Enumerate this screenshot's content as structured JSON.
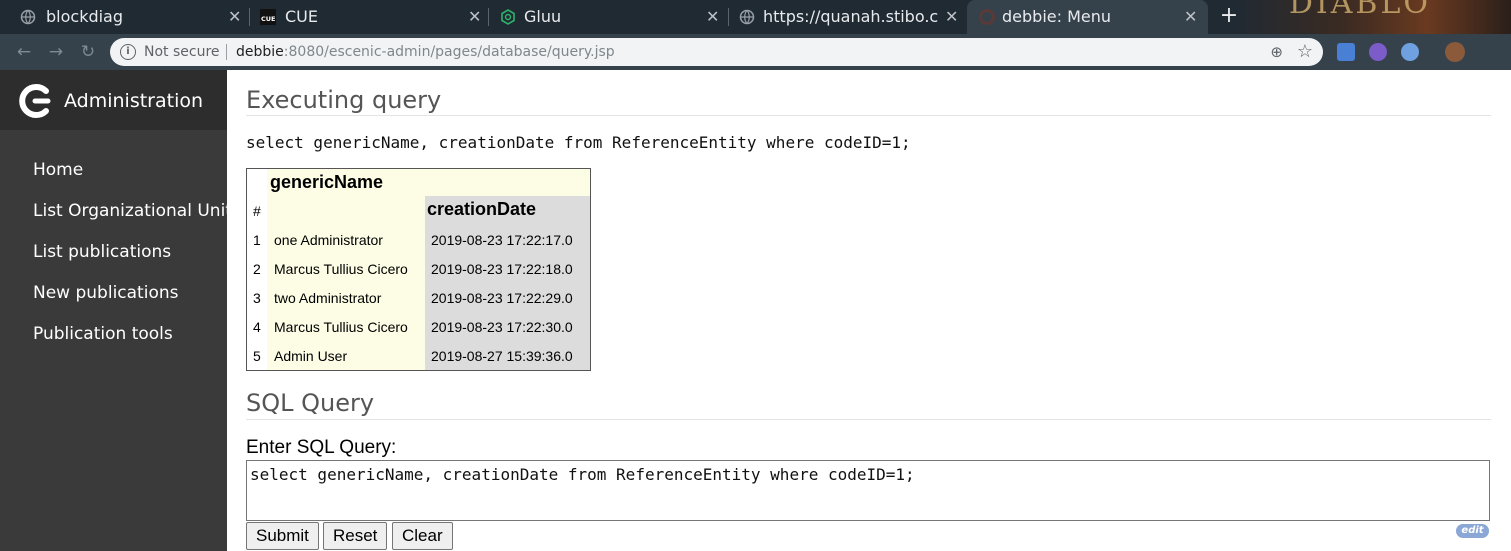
{
  "browser": {
    "tabs": [
      {
        "title": "blockdiag",
        "icon": "globe-icon"
      },
      {
        "title": "CUE",
        "icon": "cue-favicon"
      },
      {
        "title": "Gluu",
        "icon": "gluu-favicon"
      },
      {
        "title": "https://quanah.stibo.co",
        "icon": "globe-icon"
      },
      {
        "title": "debbie: Menu",
        "icon": "escenic-favicon",
        "active": true
      }
    ],
    "background_art_text": "DIABLO",
    "address": {
      "security_label": "Not secure",
      "url_host": "debbie",
      "url_rest": ":8080/escenic-admin/pages/database/query.jsp"
    }
  },
  "sidebar": {
    "brand": "Administration",
    "items": [
      {
        "label": "Home"
      },
      {
        "label": "List Organizational Units"
      },
      {
        "label": "List publications"
      },
      {
        "label": "New publications"
      },
      {
        "label": "Publication tools"
      }
    ]
  },
  "main": {
    "executing_heading": "Executing query",
    "executed_query": "select genericName, creationDate from ReferenceEntity where codeID=1;",
    "result": {
      "col_index_header": "#",
      "col1_header": "genericName",
      "col2_header": "creationDate",
      "rows": [
        {
          "index": "1",
          "name": "one Administrator",
          "date": "2019-08-23 17:22:17.0"
        },
        {
          "index": "2",
          "name": "Marcus Tullius Cicero",
          "date": "2019-08-23 17:22:18.0"
        },
        {
          "index": "3",
          "name": "two Administrator",
          "date": "2019-08-23 17:22:29.0"
        },
        {
          "index": "4",
          "name": "Marcus Tullius Cicero",
          "date": "2019-08-23 17:22:30.0"
        },
        {
          "index": "5",
          "name": "Admin User",
          "date": "2019-08-27 15:39:36.0"
        }
      ]
    },
    "sql_heading": "SQL Query",
    "sql_label": "Enter SQL Query:",
    "sql_value": "select genericName, creationDate from ReferenceEntity where codeID=1;",
    "buttons": {
      "submit": "Submit",
      "reset": "Reset",
      "clear": "Clear"
    },
    "edit_badge": "edit"
  }
}
